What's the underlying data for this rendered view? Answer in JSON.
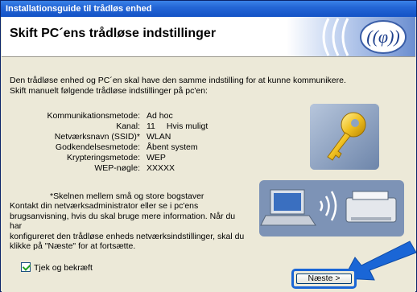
{
  "window": {
    "title": "Installationsguide til trådløs enhed"
  },
  "header": {
    "title": "Skift PC´ens trådløse indstillinger"
  },
  "intro": {
    "line1": "Den trådløse enhed og PC´en skal have den samme indstilling for at kunne kommunikere.",
    "line2": "Skift manuelt følgende trådløse indstillinger på pc'en:"
  },
  "settings": [
    {
      "label": "Kommunikationsmetode:",
      "value": "Ad hoc",
      "extra": ""
    },
    {
      "label": "Kanal:",
      "value": "11",
      "extra": "Hvis muligt"
    },
    {
      "label": "Netværksnavn (SSID)*",
      "value": "WLAN",
      "extra": ""
    },
    {
      "label": "Godkendelsesmetode:",
      "value": "Åbent system",
      "extra": ""
    },
    {
      "label": "Krypteringsmetode:",
      "value": "WEP",
      "extra": ""
    },
    {
      "label": "WEP-nøgle:",
      "value": "XXXXX",
      "extra": ""
    }
  ],
  "note": "*Skelnen mellem små og store bogstaver",
  "contact": {
    "line1": "Kontakt din netværksadministrator eller se i pc'ens",
    "line2": "brugsanvisning, hvis du skal bruge mere information. Når du har",
    "line3": "konfigureret den trådløse enheds netværksindstillinger, skal du",
    "line4": "klikke på \"Næste\" for at fortsætte."
  },
  "checkbox": {
    "label": "Tjek og bekræft",
    "checked": true
  },
  "buttons": {
    "next": "Næste >"
  },
  "colors": {
    "titlebar": "#2466d6",
    "highlight": "#1a66d6",
    "window_bg": "#ece9d8"
  }
}
